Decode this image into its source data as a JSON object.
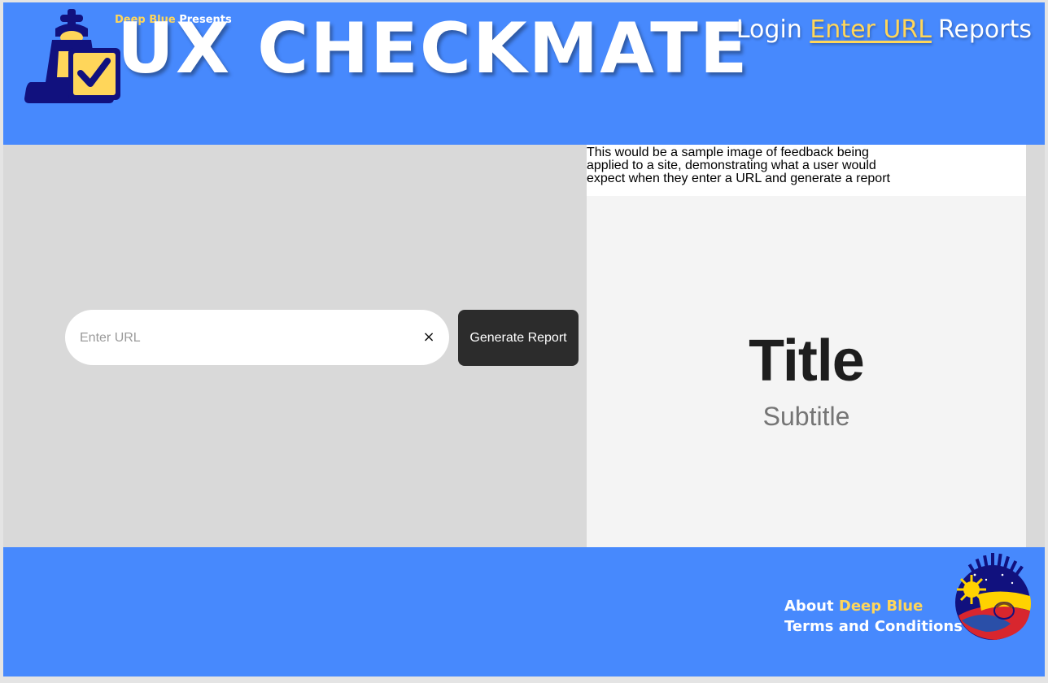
{
  "header": {
    "presents_brand": "Deep Blue",
    "presents_text": " Presents",
    "title": "UX CHECKMATE"
  },
  "nav": {
    "items": [
      {
        "label": "Login"
      },
      {
        "label": "Enter URL",
        "active": true
      },
      {
        "label": "Reports"
      }
    ]
  },
  "search": {
    "placeholder": "Enter URL",
    "value": "",
    "clear_icon": "×",
    "button_label": "Generate Report"
  },
  "sample": {
    "caption": "This would be a sample image of feedback being\napplied to a site, demonstrating what a user would\nexpect when they enter a URL and generate a report",
    "title": "Title",
    "subtitle": "Subtitle"
  },
  "footer": {
    "about_prefix": "About",
    "about_brand": "Deep Blue",
    "terms": "Terms and Conditions"
  },
  "colors": {
    "brand_blue": "#4789fd",
    "accent_yellow": "#ffd65a",
    "logo_navy": "#11117e",
    "button_dark": "#2c2c2c"
  },
  "icons": {
    "logo": "chess-king-checkbox-icon",
    "clear": "close-icon",
    "partner": "sun-crown-emblem-icon"
  }
}
